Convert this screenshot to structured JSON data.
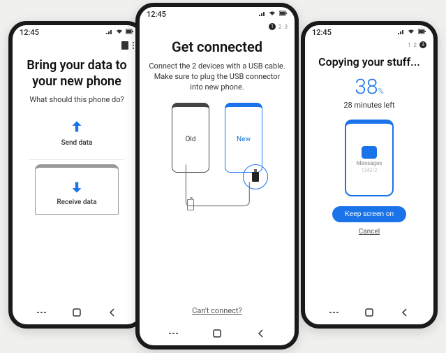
{
  "statusbar": {
    "time": "12:45"
  },
  "pager": {
    "step1": "1",
    "step2": "2",
    "step3": "3"
  },
  "left": {
    "heading": "Bring your data to your new phone",
    "sub": "What should this phone do?",
    "send_label": "Send data",
    "receive_label": "Receive data"
  },
  "center": {
    "heading": "Get connected",
    "sub": "Connect the 2 devices with a USB cable. Make sure to plug the USB connector into new phone.",
    "old_label": "Old",
    "new_label": "New",
    "cant": "Can't connect?"
  },
  "right": {
    "heading": "Copying your stuff...",
    "percent": "38",
    "percent_unit": "%",
    "time_left": "28 minutes left",
    "item_label": "Messages",
    "item_count": "1243/2",
    "keep_on": "Keep screen on",
    "cancel": "Cancel"
  }
}
